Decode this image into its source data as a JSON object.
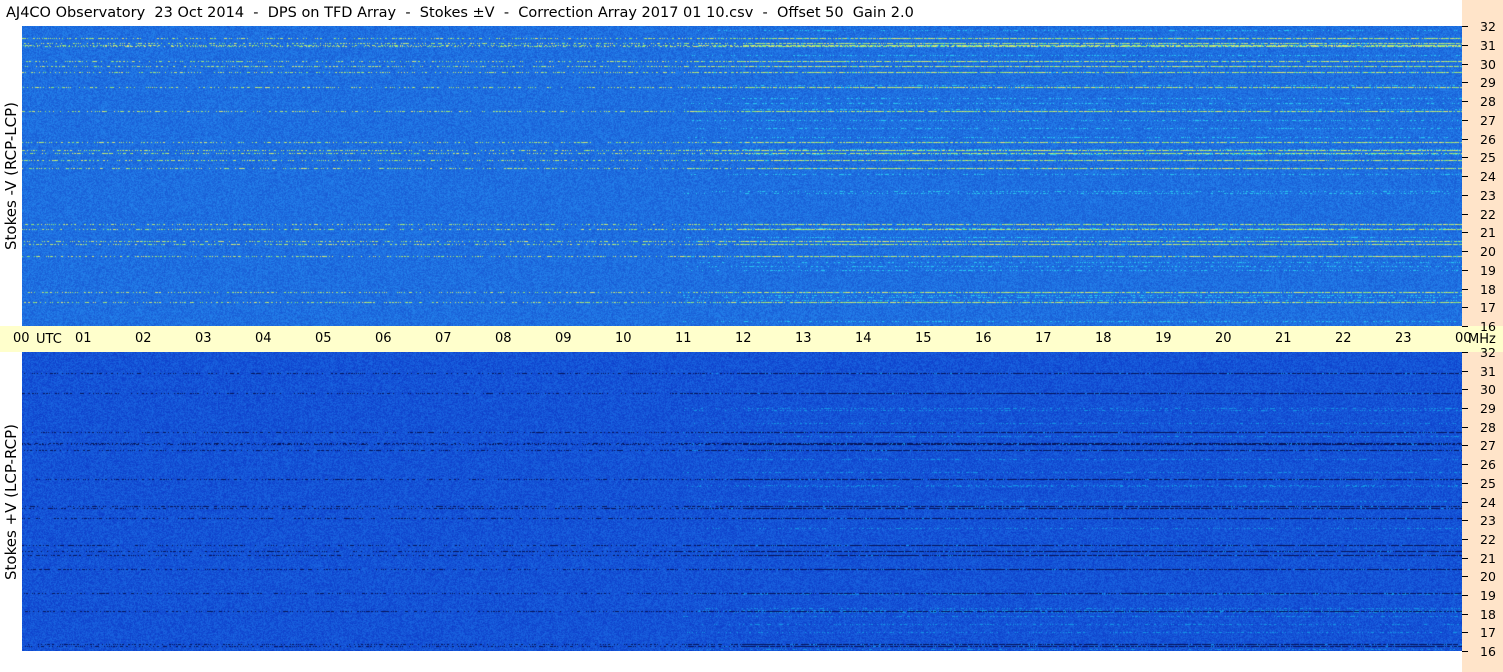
{
  "title": "AJ4CO Observatory  23 Oct 2014  -  DPS on TFD Array  -  Stokes ±V  -  Correction Array 2017 01 10.csv  -  Offset 50  Gain 2.0",
  "chart_data": {
    "type": "heatmap",
    "title": "AJ4CO Observatory  23 Oct 2014  -  DPS on TFD Array  -  Stokes ±V  -  Correction Array 2017 01 10.csv  -  Offset 50  Gain 2.0",
    "x_axis": {
      "unit": "UTC",
      "ticks": [
        "00",
        "01",
        "02",
        "03",
        "04",
        "05",
        "06",
        "07",
        "08",
        "09",
        "10",
        "11",
        "12",
        "13",
        "14",
        "15",
        "16",
        "17",
        "18",
        "19",
        "20",
        "21",
        "22",
        "23",
        "00"
      ],
      "range": [
        0,
        24
      ]
    },
    "y_axis": {
      "unit": "MHz",
      "ticks": [
        "32",
        "31",
        "30",
        "29",
        "28",
        "27",
        "26",
        "25",
        "24",
        "23",
        "22",
        "21",
        "20",
        "19",
        "18",
        "17",
        "16"
      ],
      "range": [
        16,
        32
      ]
    },
    "panels": [
      {
        "label": "Stokes -V (RCP-LCP)",
        "base_color": "#1e6fe0"
      },
      {
        "label": "Stokes +V (LCP-RCP)",
        "base_color": "#1453d6"
      }
    ],
    "colormap": [
      "#000050",
      "#0a2fb8",
      "#1e78ee",
      "#20c8f0",
      "#a0f070",
      "#f0f040",
      "#ff4040"
    ]
  }
}
